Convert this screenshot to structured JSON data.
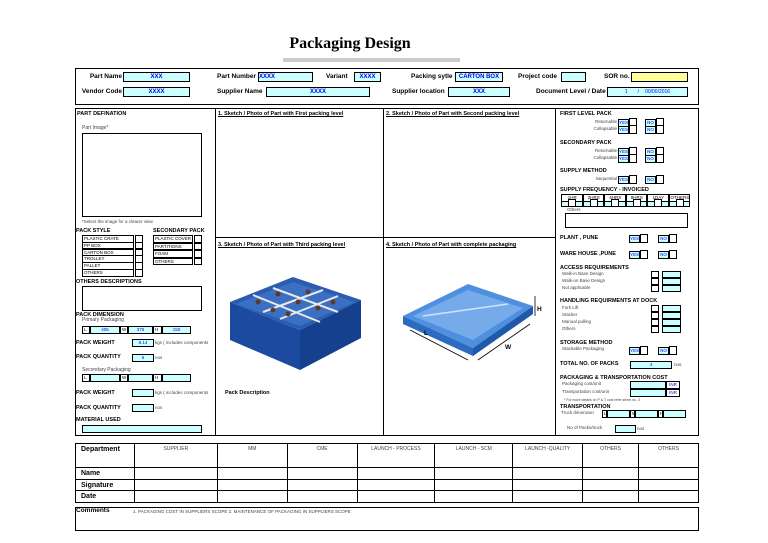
{
  "title": "Packaging Design",
  "header": {
    "part_name_label": "Part Name",
    "part_name": "XXX",
    "part_number_label": "Part Number",
    "part_number": "XXXX",
    "variant_label": "Variant",
    "variant": "XXXX",
    "packing_style_label": "Packing sytle",
    "packing_style": "CARTON BOX",
    "project_code_label": "Project code",
    "project_code": "",
    "sor_label": "SOR no.",
    "sor": "",
    "vendor_code_label": "Vendor Code",
    "vendor_code": "XXXX",
    "supplier_name_label": "Supplier Name",
    "supplier_name": "XXXX",
    "supplier_location_label": "Supplier location",
    "supplier_location": "XXX",
    "doc_level_label": "Document Level / Date",
    "doc_level": "1",
    "doc_sep": "/",
    "doc_date": "00/00/2016"
  },
  "part": {
    "heading": "PART DEFINATION",
    "image_label": "Part Image*",
    "image_note": "*Select the image for a clearer view",
    "pack_style_heading": "PACK STYLE",
    "pack_style": [
      "PLASTIC CRATE",
      "PP BOX",
      "CARTON BOX",
      "TROLLEY",
      "PALLET",
      "OTHERS"
    ],
    "secondary_heading": "SECONDARY PACK",
    "secondary": [
      "PLASTIC COVER",
      "PARTITIONS",
      "FOAM",
      "OTHERS"
    ],
    "others_desc": "OTHERS DESCRIPTIONS",
    "dimension_heading": "PACK DIMENSION",
    "primary": "Primary Packaging",
    "L": "L",
    "W": "W",
    "H": "H",
    "len": "405",
    "wid": "375",
    "hei": "150",
    "weight_label": "PACK WEIGHT",
    "weight": "8.14",
    "weight_unit": "kgs ( includes components",
    "qty_label": "PACK QUANTITY",
    "qty": "6",
    "qty_unit": "nos",
    "secondary_pack": "Secondary Packaging",
    "weight2": "",
    "qty2": "",
    "material": "MATERIAL USED"
  },
  "sketch": {
    "s1": "1. Sketch / Photo of Part with First packing level",
    "s2": "2. Sketch / Photo of Part with Second packing level",
    "s3": "3. Sketch / Photo of Part with Third packing level",
    "s4": "4. Sketch / Photo of Part with complete packaging",
    "dim_h": "H",
    "dim_l": "L",
    "dim_w": "W",
    "pack_description": "Pack Description"
  },
  "right": {
    "yes": "YES",
    "no": "NO",
    "first_level": "FIRST LEVEL PACK",
    "returnable": "Returnable",
    "collapsable": "Collapsable",
    "secondary": "SECONDARY PACK",
    "supply_method": "SUPPLY METHOD",
    "sequential": "Sequential",
    "supply_freq": "SUPPLY FREQUENCY - INVOICED",
    "freq": [
      "1HR",
      "2HRS",
      "4HRS",
      "8HRS",
      "1DAY",
      "OTHERS"
    ],
    "others": "Others",
    "plant": "PLANT , PUNE",
    "warehouse": "WARE HOUSE ,PUNE",
    "access": "ACCESS REQUIREMENTS",
    "access_items": [
      "Walk-in Base Design",
      "Walk-on Base Design",
      "Not applicable"
    ],
    "handling": "HANDLING REQUIRMENTS AT DOCK",
    "handling_items": [
      "Fork Lift",
      "Stacker",
      "Manual pulling",
      "Others"
    ],
    "storage": "STORAGE METHOD",
    "stackable": "Stackable  Packaging",
    "total_packs_label": "TOTAL NO. OF PACKS",
    "total_packs": "4",
    "total_unit": "nos.",
    "cost_heading": "PACKAGING & TRANSPORTATION COST",
    "pack_cost": "Packaging cost/unit",
    "trans_cost": "Transportation cost/unit",
    "inr": "INR",
    "cost_note": "* For more details on P & T cost refer sheet no. 3",
    "transport": "TRANSPORTATION",
    "truck_dim": "Truck dimension",
    "L": "L",
    "W": "W",
    "H": "H",
    "packs_truck": "No of Packs/truck",
    "packs_truck_unit": "nos"
  },
  "approval": {
    "departments": [
      "SUPPLIER",
      "MM",
      "CME",
      "LAUNCH - PROCESS",
      "LAUNCH - SCM",
      "LAUNCH -QUALITY",
      "OTHERS",
      "OTHERS"
    ],
    "rows": [
      "Department",
      "Name",
      "Signature",
      "Date"
    ]
  },
  "comments": {
    "label": "Comments",
    "text": "1. PACKAGING COST IN SUPPLIERS SCOPE   2. MAINTENANCE OF PACKAGING IN SUPPLIERS SCOPE"
  }
}
